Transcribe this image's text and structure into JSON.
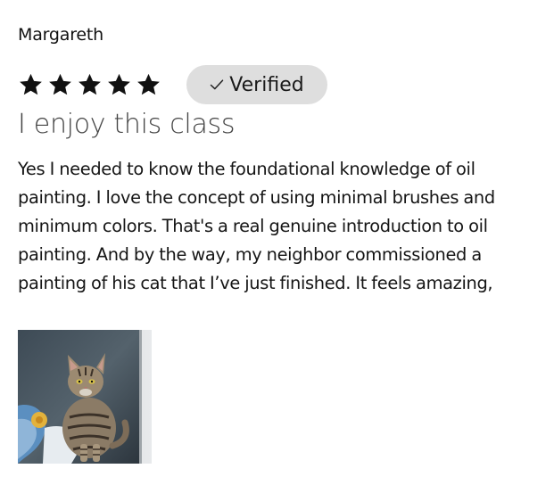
{
  "review": {
    "reviewer_name": "Margareth",
    "rating": {
      "value": 5,
      "max": 5,
      "icon": "star-icon",
      "color": "#111111"
    },
    "verified_badge": {
      "icon": "check-icon",
      "label": "Verified",
      "background": "#dedede"
    },
    "title": "I enjoy this class",
    "body": "Yes I needed to know the foundational knowledge of oil painting. I love the concept of using minimal brushes and minimum colors. That's a real genuine introduction to oil painting. And by the way, my neighbor commissioned a painting of his cat that I’ve just finished. It feels amazing,",
    "attachments": [
      {
        "type": "photo",
        "subject": "oil painting of a tabby cat"
      }
    ]
  }
}
